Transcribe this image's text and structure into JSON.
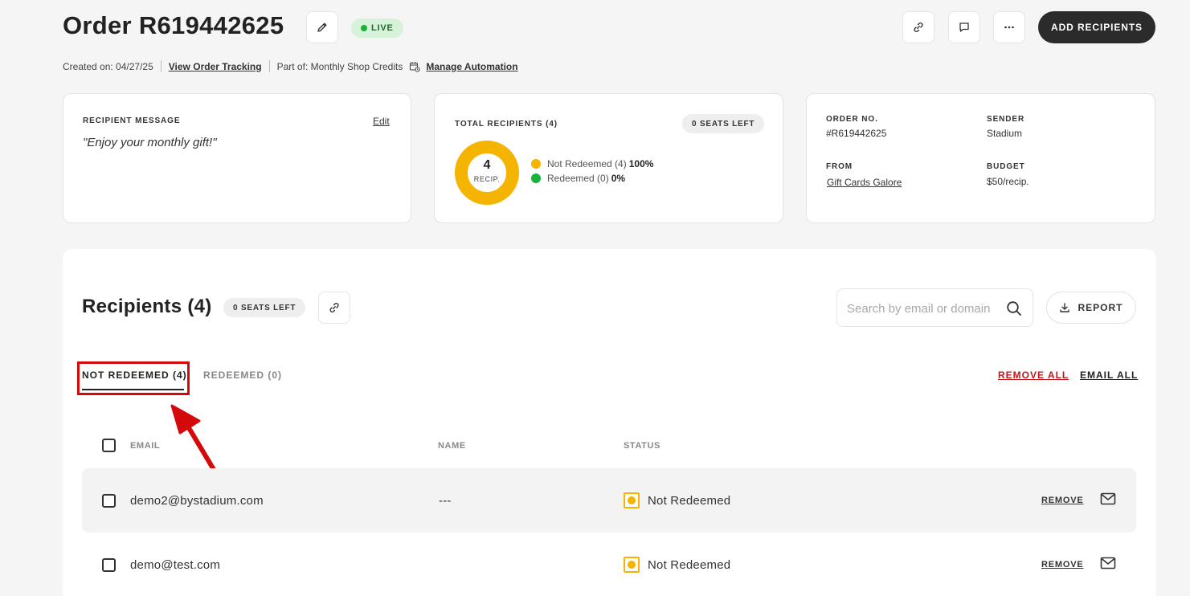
{
  "header": {
    "title": "Order R619442625",
    "status_badge": "LIVE",
    "add_recipients_label": "ADD RECIPIENTS",
    "created_label": "Created on: 04/27/25",
    "view_tracking_label": "View Order Tracking",
    "part_of_label": "Part of: Monthly Shop Credits",
    "manage_automation_label": "Manage Automation"
  },
  "message_card": {
    "caption": "RECIPIENT MESSAGE",
    "edit_label": "Edit",
    "message": "\"Enjoy your monthly gift!\""
  },
  "recipients_card": {
    "caption": "TOTAL RECIPIENTS (4)",
    "seats_pill": "0 SEATS LEFT",
    "donut_count": "4",
    "donut_unit": "RECIP.",
    "legend": [
      {
        "label": "Not Redeemed (4)",
        "pct": "100%",
        "color": "#f4b400"
      },
      {
        "label": "Redeemed (0)",
        "pct": "0%",
        "color": "#19b33a"
      }
    ]
  },
  "chart_data": {
    "type": "pie",
    "categories": [
      "Not Redeemed",
      "Redeemed"
    ],
    "values": [
      4,
      0
    ],
    "colors": [
      "#f4b400",
      "#19b33a"
    ]
  },
  "order_card": {
    "order_no_caption": "ORDER NO.",
    "order_no": "#R619442625",
    "sender_caption": "SENDER",
    "sender": "Stadium",
    "from_caption": "FROM",
    "from": "Gift Cards Galore",
    "budget_caption": "BUDGET",
    "budget": "$50/recip."
  },
  "recipients": {
    "title": "Recipients (4)",
    "seats_pill": "0 SEATS LEFT",
    "search_placeholder": "Search by email or domain",
    "report_label": "REPORT",
    "tabs": [
      {
        "label": "NOT REDEEMED (4)",
        "active": true
      },
      {
        "label": "REDEEMED (0)",
        "active": false
      }
    ],
    "remove_all_label": "REMOVE ALL",
    "email_all_label": "EMAIL ALL",
    "columns": [
      "EMAIL",
      "NAME",
      "STATUS"
    ],
    "rows": [
      {
        "email": "demo2@bystadium.com",
        "name": "---",
        "status": "Not Redeemed",
        "remove_label": "REMOVE"
      },
      {
        "email": "demo@test.com",
        "name": "",
        "status": "Not Redeemed",
        "remove_label": "REMOVE"
      }
    ]
  },
  "colors": {
    "accent_yellow": "#f4b400",
    "accent_green": "#19b33a",
    "danger_red": "#d40a0a",
    "dark_button": "#2b2b2b"
  }
}
